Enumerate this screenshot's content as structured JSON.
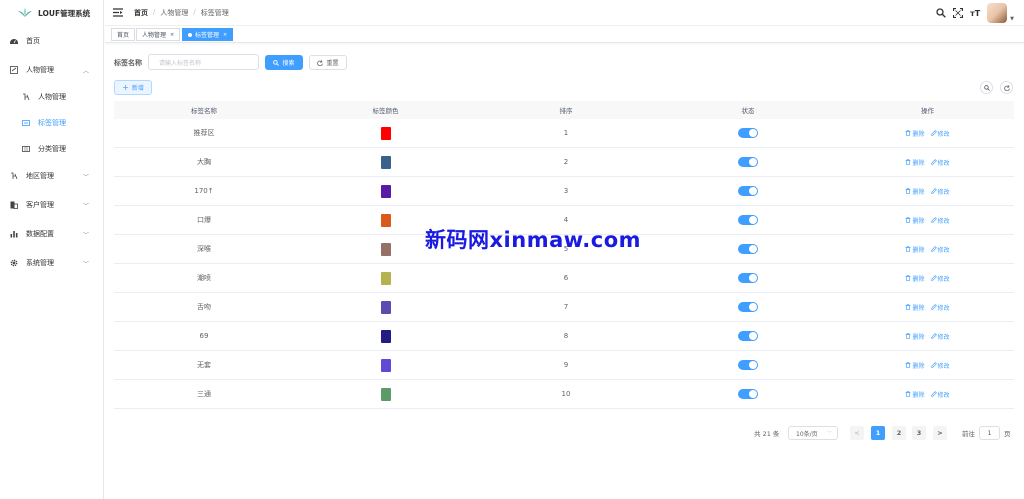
{
  "app": {
    "title": "LOUF管理系统"
  },
  "sidebar": {
    "items": [
      {
        "label": "首页",
        "icon": "dashboard-icon"
      },
      {
        "label": "人物管理",
        "icon": "user-icon",
        "expanded": true
      },
      {
        "label": "人物管理",
        "icon": "person-sub-icon",
        "sub": true
      },
      {
        "label": "标签管理",
        "icon": "tag-icon",
        "sub": true,
        "active": true
      },
      {
        "label": "分类管理",
        "icon": "category-icon",
        "sub": true
      },
      {
        "label": "地区管理",
        "icon": "location-icon"
      },
      {
        "label": "客户管理",
        "icon": "client-icon"
      },
      {
        "label": "数据配置",
        "icon": "bar-chart-icon"
      },
      {
        "label": "系统管理",
        "icon": "gear-icon"
      }
    ]
  },
  "header": {
    "breadcrumb": {
      "home": "首页",
      "sep": "/",
      "items": [
        "人物管理",
        "标签管理"
      ]
    },
    "font_size_icon": "тT"
  },
  "tags": [
    {
      "label": "首页"
    },
    {
      "label": "人物管理",
      "close": "×"
    },
    {
      "label": "标签管理",
      "close": "×",
      "active": true
    }
  ],
  "search": {
    "label": "标签名称",
    "placeholder": "请输入标签名称",
    "search_button": "搜索",
    "reset_button": "重置",
    "add_button": "新增"
  },
  "table": {
    "headers": [
      "标签名称",
      "标签颜色",
      "排序",
      "状态",
      "操作"
    ],
    "delete_label": "删除",
    "edit_label": "修改",
    "rows": [
      {
        "name": "推荐区",
        "color": "#ff0000",
        "sort": "1",
        "enabled": true
      },
      {
        "name": "大胸",
        "color": "#3a6189",
        "sort": "2",
        "enabled": true
      },
      {
        "name": "170↑",
        "color": "#5b1aa6",
        "sort": "3",
        "enabled": true
      },
      {
        "name": "口爆",
        "color": "#d95a1a",
        "sort": "4",
        "enabled": true
      },
      {
        "name": "深喉",
        "color": "#957064",
        "sort": "5",
        "enabled": true
      },
      {
        "name": "潮喷",
        "color": "#b4b34f",
        "sort": "6",
        "enabled": true
      },
      {
        "name": "舌吻",
        "color": "#5d4bb0",
        "sort": "7",
        "enabled": true
      },
      {
        "name": "69",
        "color": "#241b82",
        "sort": "8",
        "enabled": true
      },
      {
        "name": "无套",
        "color": "#6149d8",
        "sort": "9",
        "enabled": true
      },
      {
        "name": "三通",
        "color": "#5d9a6a",
        "sort": "10",
        "enabled": true
      }
    ]
  },
  "pagination": {
    "total": "共 21 条",
    "page_size": "10条/页",
    "prev": "<",
    "pages": [
      "1",
      "2",
      "3"
    ],
    "next": ">",
    "goto_label": "前往",
    "goto_value": "1",
    "page_suffix": "页"
  },
  "watermark": "新码网xinmaw.com",
  "colors": {
    "primary": "#409eff"
  }
}
